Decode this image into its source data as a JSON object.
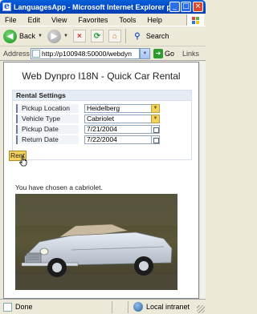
{
  "window": {
    "title": "LanguagesApp - Microsoft Internet Explorer pr...",
    "minimize_glyph": "_",
    "maximize_glyph": "□",
    "close_glyph": "×"
  },
  "menu": {
    "items": [
      "File",
      "Edit",
      "View",
      "Favorites",
      "Tools",
      "Help"
    ]
  },
  "toolbar": {
    "back_label": "Back",
    "search_label": "Search"
  },
  "address": {
    "label": "Address",
    "url": "http://p100948:50000/webdyn",
    "go_label": "Go",
    "links_label": "Links"
  },
  "page": {
    "title": "Web Dynpro I18N - Quick Car Rental",
    "group_title": "Rental Settings",
    "fields": [
      {
        "label": "Pickup Location",
        "value": "Heidelberg"
      },
      {
        "label": "Vehicle Type",
        "value": "Cabriolet"
      },
      {
        "label": "Pickup Date",
        "value": "7/21/2004"
      },
      {
        "label": "Return Date",
        "value": "7/22/2004"
      }
    ],
    "rent_label": "Rent",
    "message": "You have chosen a cabriolet."
  },
  "status": {
    "text": "Done",
    "zone": "Local intranet"
  },
  "colors": {
    "titlebar": "#0348c5",
    "button_yellow": "#f5d35a",
    "group_header": "#e5ecf4"
  }
}
